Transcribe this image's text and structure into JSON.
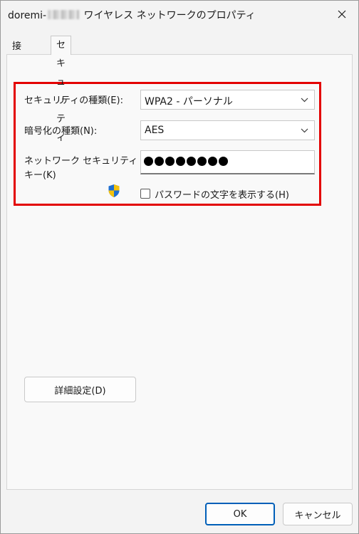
{
  "window": {
    "title_prefix": "doremi-",
    "title_suffix": " ワイヤレス ネットワークのプロパティ"
  },
  "tabs": [
    {
      "label": "接続",
      "active": false
    },
    {
      "label": "セキュリティ",
      "active": true
    }
  ],
  "security": {
    "type_label": "セキュリティの種類(E):",
    "type_value": "WPA2 - パーソナル",
    "encryption_label": "暗号化の種類(N):",
    "encryption_value": "AES",
    "key_label_line1": "ネットワーク セキュリティ",
    "key_label_line2": "キー(K)",
    "password_dots": 8,
    "show_chars_label": "パスワードの文字を表示する(H)",
    "show_chars_checked": false
  },
  "buttons": {
    "advanced": "詳細設定(D)",
    "ok": "OK",
    "cancel": "キャンセル"
  },
  "colors": {
    "highlight": "#e30000",
    "accent": "#005fb8",
    "shield_blue": "#1f6fd1",
    "shield_yellow": "#f4c20d"
  },
  "icons": {
    "close": "close-icon",
    "chevron": "chevron-down-icon",
    "shield": "uac-shield-icon"
  }
}
